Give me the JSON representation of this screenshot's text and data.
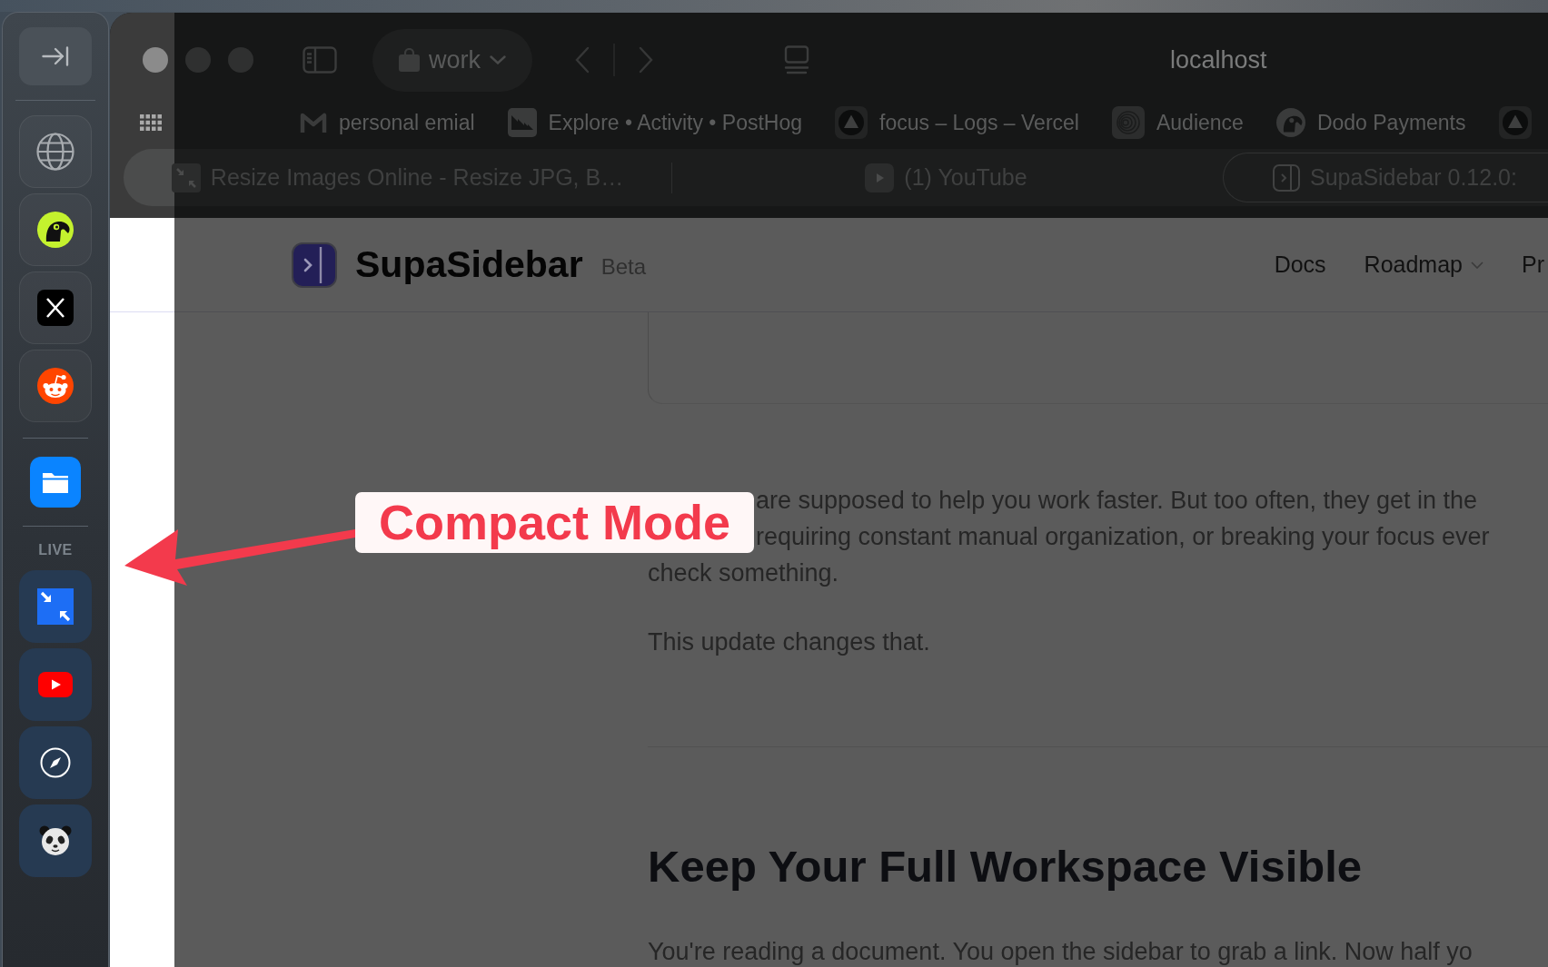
{
  "sidebar": {
    "pinned": [
      {
        "kind": "globe"
      },
      {
        "kind": "bird"
      },
      {
        "kind": "cross"
      },
      {
        "kind": "alien"
      }
    ],
    "apps": [
      {
        "kind": "folder"
      }
    ],
    "live_label": "LIVE",
    "live": [
      {
        "kind": "shrink"
      },
      {
        "kind": "play"
      },
      {
        "kind": "compass"
      },
      {
        "kind": "panda"
      }
    ]
  },
  "browser": {
    "space": "work",
    "address": "localhost",
    "favorites": [
      {
        "label": "personal emial",
        "kind": "mail"
      },
      {
        "label": "Explore • Activity • PostHog",
        "kind": "stripes"
      },
      {
        "label": "focus – Logs – Vercel",
        "kind": "triangle"
      },
      {
        "label": "Audience",
        "kind": "rings"
      },
      {
        "label": "Dodo Payments",
        "kind": "bird"
      },
      {
        "kind": "triangle"
      }
    ],
    "tabs": [
      {
        "title": "Resize Images Online - Resize JPG, B…",
        "kind": "shrink",
        "selected": false
      },
      {
        "title": "(1) YouTube",
        "kind": "play",
        "selected": false
      },
      {
        "title": "SupaSidebar 0.12.0:",
        "kind": "panel",
        "selected": true
      }
    ]
  },
  "page": {
    "brand": "SupaSidebar",
    "badge": "Beta",
    "nav": [
      {
        "label": "Docs",
        "dropdown": false
      },
      {
        "label": "Roadmap",
        "dropdown": true
      },
      {
        "label": "Pr",
        "dropdown": false
      }
    ],
    "intro_lines": [
      "are supposed to help you work faster. But too often, they get in the",
      "requiring constant manual organization, or breaking your focus ever",
      "check something."
    ],
    "paragraph": "This update changes that.",
    "heading": "Keep Your Full Workspace Visible",
    "body": "You're reading a document. You open the sidebar to grab a link. Now half yo"
  },
  "annotation": {
    "label": "Compact Mode"
  }
}
